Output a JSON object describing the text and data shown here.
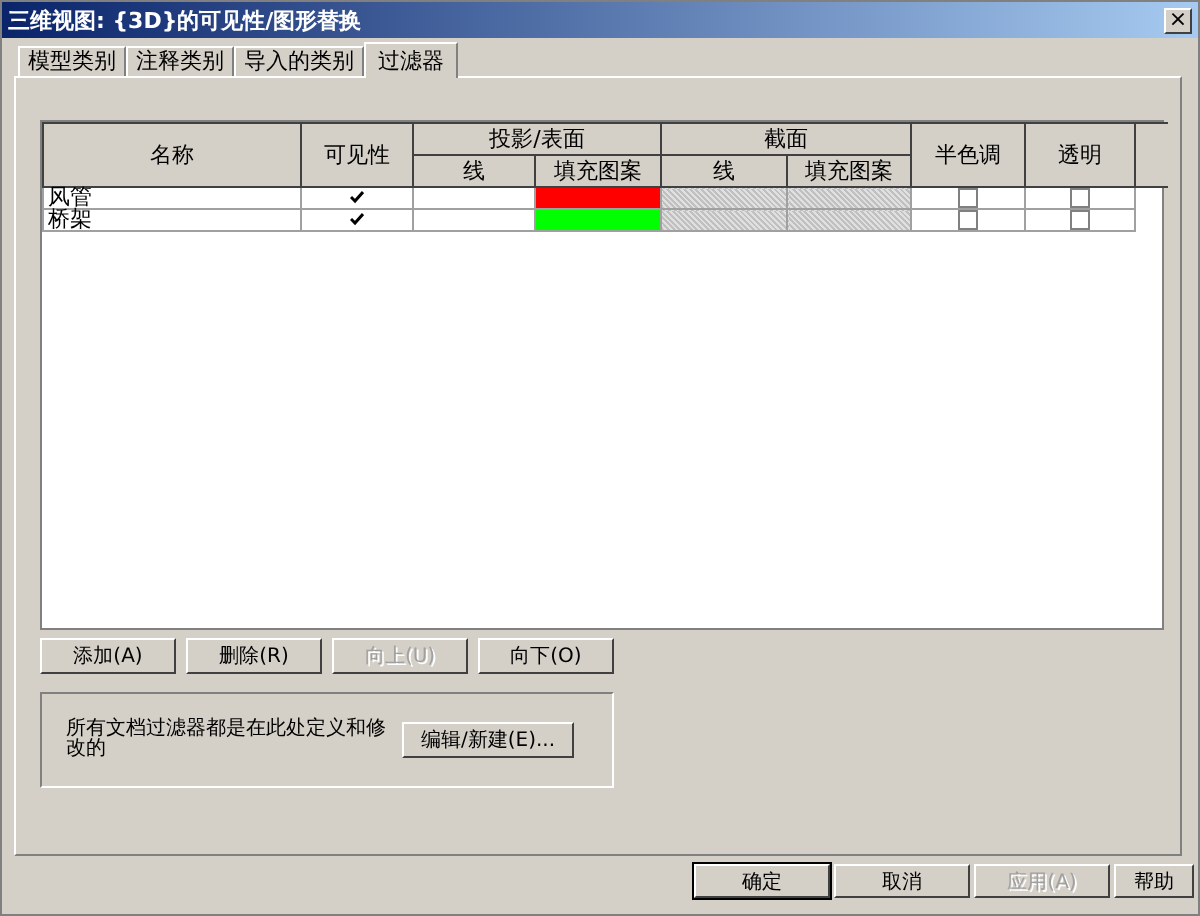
{
  "window": {
    "title": "三维视图: {3D}的可见性/图形替换",
    "close": "×"
  },
  "tabs": [
    {
      "label": "模型类别",
      "selected": false
    },
    {
      "label": "注释类别",
      "selected": false
    },
    {
      "label": "导入的类别",
      "selected": false
    },
    {
      "label": "过滤器",
      "selected": true
    }
  ],
  "table": {
    "columns": {
      "name": "名称",
      "visibility": "可见性",
      "projection": "投影/表面",
      "projection_line": "线",
      "projection_fill": "填充图案",
      "cut": "截面",
      "cut_line": "线",
      "cut_fill": "填充图案",
      "halftone": "半色调",
      "transparent": "透明"
    },
    "rows": [
      {
        "name": "风管",
        "visible": true,
        "color": "#ff0000",
        "halftone": false,
        "transparent": false
      },
      {
        "name": "桥架",
        "visible": true,
        "color": "#00ff00",
        "halftone": false,
        "transparent": false
      }
    ]
  },
  "row_buttons": [
    {
      "label": "添加(A)",
      "disabled": false
    },
    {
      "label": "删除(R)",
      "disabled": false
    },
    {
      "label": "向上(U)",
      "disabled": true
    },
    {
      "label": "向下(O)",
      "disabled": false
    }
  ],
  "info": {
    "text": "所有文档过滤器都是在此处定义和修改的",
    "button": "编辑/新建(E)..."
  },
  "dialog_buttons": [
    {
      "label": "确定",
      "disabled": false,
      "default": true
    },
    {
      "label": "取消",
      "disabled": false,
      "default": false
    },
    {
      "label": "应用(A)",
      "disabled": true,
      "default": false
    },
    {
      "label": "帮助",
      "disabled": false,
      "default": false
    }
  ]
}
